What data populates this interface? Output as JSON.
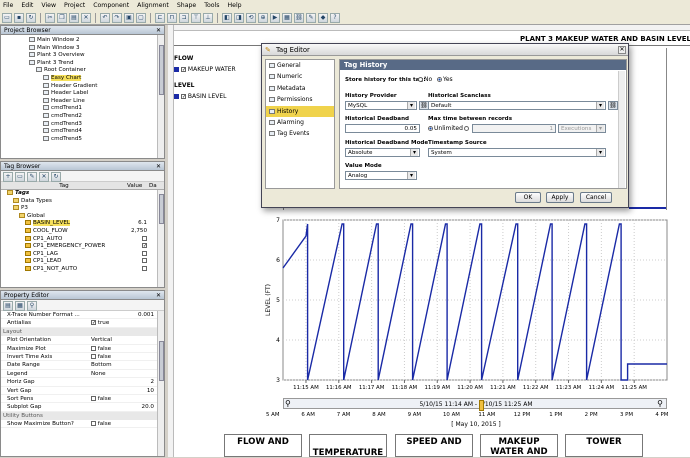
{
  "menu": [
    "File",
    "Edit",
    "View",
    "Project",
    "Component",
    "Alignment",
    "Shape",
    "Tools",
    "Help"
  ],
  "project_browser": {
    "title": "Project Browser",
    "items": [
      {
        "label": "Main Window 2",
        "indent": 4
      },
      {
        "label": "Main Window 3",
        "indent": 4
      },
      {
        "label": "Plant 3 Overview",
        "indent": 4
      },
      {
        "label": "Plant 3 Trend",
        "indent": 4
      },
      {
        "label": "Root Container",
        "indent": 5
      },
      {
        "label": "Easy Chart",
        "indent": 6,
        "selected": true
      },
      {
        "label": "Header Gradient",
        "indent": 6
      },
      {
        "label": "Header Label",
        "indent": 6
      },
      {
        "label": "Header Line",
        "indent": 6
      },
      {
        "label": "cmdTrend1",
        "indent": 6
      },
      {
        "label": "cmdTrend2",
        "indent": 6
      },
      {
        "label": "cmdTrend3",
        "indent": 6
      },
      {
        "label": "cmdTrend4",
        "indent": 6
      },
      {
        "label": "cmdTrend5",
        "indent": 6
      }
    ]
  },
  "tag_browser": {
    "title": "Tag Browser",
    "col_tag": "Tag",
    "col_value": "Value",
    "col_data": "Da",
    "rows": [
      {
        "label": "Tags",
        "indent": 1,
        "value": "",
        "italic": true
      },
      {
        "label": "Data Types",
        "indent": 2,
        "value": ""
      },
      {
        "label": "P3",
        "indent": 2,
        "value": ""
      },
      {
        "label": "Global",
        "indent": 3,
        "value": ""
      },
      {
        "label": "BASIN_LEVEL",
        "indent": 4,
        "value": "6.1",
        "selected": true
      },
      {
        "label": "COOL_FLOW",
        "indent": 4,
        "value": "2,750"
      },
      {
        "label": "CP1_AUTO",
        "indent": 4,
        "value": "",
        "check": false
      },
      {
        "label": "CP1_EMERGENCY_POWER",
        "indent": 4,
        "value": "",
        "check": true
      },
      {
        "label": "CP1_LAG",
        "indent": 4,
        "value": "",
        "check": false
      },
      {
        "label": "CP1_LEAD",
        "indent": 4,
        "value": "",
        "check": false
      },
      {
        "label": "CP1_NOT_AUTO",
        "indent": 4,
        "value": "",
        "check": false
      }
    ]
  },
  "property_editor": {
    "title": "Property Editor",
    "rows": [
      {
        "key": "X-Trace Number Format ...",
        "value": "0.001"
      },
      {
        "key": "Antialias",
        "value": "true",
        "check": true
      },
      {
        "category": "Layout"
      },
      {
        "key": "Plot Orientation",
        "value": "Vertical"
      },
      {
        "key": "Maximize Plot",
        "value": "false",
        "check": false
      },
      {
        "key": "Invert Time Axis",
        "value": "false",
        "check": false
      },
      {
        "key": "Date Range",
        "value": "Bottom"
      },
      {
        "key": "Legend",
        "value": "None"
      },
      {
        "key": "Horiz Gap",
        "value": "2"
      },
      {
        "key": "Vert Gap",
        "value": "10"
      },
      {
        "key": "Sort Pens",
        "value": "false",
        "check": false
      },
      {
        "key": "Subplot Gap",
        "value": "20.0"
      },
      {
        "category": "Utility Buttons"
      },
      {
        "key": "Show Maximize Button?",
        "value": "false",
        "check": false
      }
    ]
  },
  "canvas": {
    "header_title": "PLANT 3 MAKEUP WATER AND BASIN LEVEL",
    "flow_group": "FLOW",
    "flow_pen": "MAKEUP WATER",
    "level_group": "LEVEL",
    "level_pen": "BASIN LEVEL",
    "pen_color": "#1a2aa6"
  },
  "tag_editor": {
    "title": "Tag Editor",
    "nav": [
      "General",
      "Numeric",
      "Metadata",
      "Permissions",
      "History",
      "Alarming",
      "Tag Events"
    ],
    "nav_selected": 4,
    "section_title": "Tag History",
    "store_history_label": "Store history for this tag:",
    "no_label": "No",
    "yes_label": "Yes",
    "store_history": "Yes",
    "history_provider_label": "History Provider",
    "history_provider_value": "MySQL",
    "scanclass_label": "Historical Scanclass",
    "scanclass_value": "Default",
    "deadband_label": "Historical Deadband",
    "deadband_value": "0.05",
    "max_time_label": "Max time between records",
    "unlimited_label": "Unlimited",
    "max_time_value": "1",
    "max_time_unit": "Executions",
    "deadband_mode_label": "Historical Deadband Mode",
    "deadband_mode_value": "Absolute",
    "timestamp_source_label": "Timestamp Source",
    "timestamp_source_value": "System",
    "value_mode_label": "Value Mode",
    "value_mode_value": "Analog",
    "ok_label": "OK",
    "apply_label": "Apply",
    "cancel_label": "Cancel"
  },
  "chart_data": {
    "type": "line",
    "ylabel": "LEVEL (FT)",
    "xlabel": "[ May 10, 2015 ]",
    "ylim": [
      3,
      7
    ],
    "y_ticks": [
      3,
      4,
      5,
      6,
      7
    ],
    "x_ticks": [
      "11:15 AM",
      "11:16 AM",
      "11:17 AM",
      "11:18 AM",
      "11:19 AM",
      "11:20 AM",
      "11:21 AM",
      "11:22 AM",
      "11:23 AM",
      "11:24 AM",
      "11:25 AM"
    ],
    "series": [
      {
        "values_desc": "sawtooth",
        "x_min": [
          14.3,
          15.0,
          15.05,
          15.05,
          16.1,
          16.15,
          16.15,
          17.15,
          17.2,
          17.2,
          18.2,
          18.25,
          18.25,
          19.25,
          19.3,
          19.3,
          20.3,
          20.35,
          20.35,
          21.4,
          21.45,
          21.45,
          22.45,
          22.5,
          22.5,
          23.5,
          23.55,
          23.55,
          24.55,
          24.6,
          24.6,
          24.8,
          24.8,
          26.0
        ],
        "y": [
          5.8,
          6.6,
          6.9,
          3.0,
          6.9,
          6.9,
          3.0,
          6.9,
          6.9,
          3.0,
          6.9,
          6.9,
          3.0,
          6.9,
          6.9,
          3.0,
          6.9,
          6.9,
          3.0,
          6.9,
          6.9,
          3.0,
          6.9,
          6.9,
          3.0,
          6.9,
          6.9,
          3.0,
          6.9,
          6.9,
          3.0,
          3.0,
          3.4,
          3.4
        ]
      }
    ],
    "range_label": "5/10/15 11:14 AM - 5/10/15 11:25 AM",
    "range_ticks": [
      "5 AM",
      "6 AM",
      "7 AM",
      "8 AM",
      "9 AM",
      "10 AM",
      "11 AM",
      "12 PM",
      "1 PM",
      "2 PM",
      "3 PM",
      "4 PM"
    ]
  },
  "bottom_buttons": [
    "FLOW AND",
    "TEMPERATURE",
    "SPEED AND",
    "MAKEUP WATER AND",
    "TOWER"
  ]
}
